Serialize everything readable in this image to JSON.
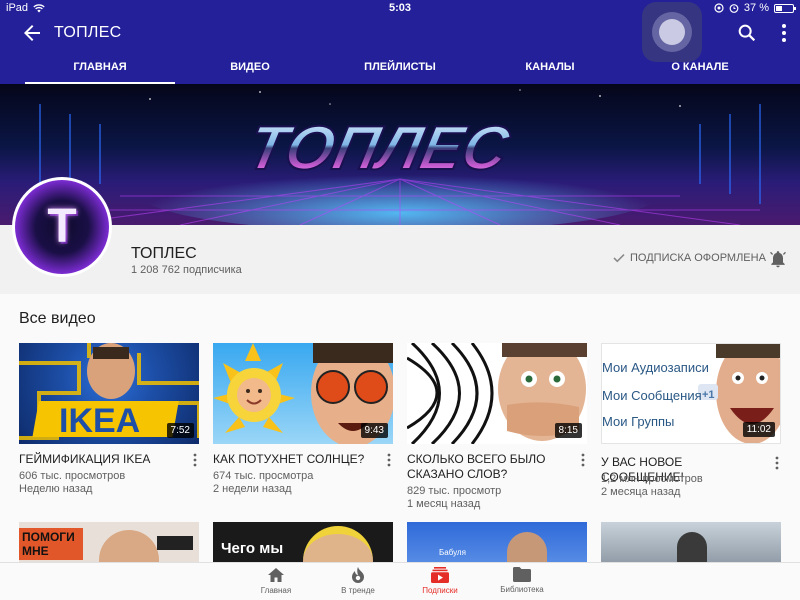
{
  "status_bar": {
    "device": "iPad",
    "time": "5:03",
    "battery": "37 %",
    "battery_level": 0.37
  },
  "header": {
    "title": "ТОПЛЕС",
    "bg_color": "#24209a"
  },
  "tabs": [
    {
      "label": "ГЛАВНАЯ",
      "active": true
    },
    {
      "label": "ВИДЕО",
      "active": false
    },
    {
      "label": "ПЛЕЙЛИСТЫ",
      "active": false
    },
    {
      "label": "КАНАЛЫ",
      "active": false
    },
    {
      "label": "О КАНАЛЕ",
      "active": false
    }
  ],
  "banner": {
    "text": "ТОПЛЕС"
  },
  "channel": {
    "avatar_letter": "T",
    "name": "ТОПЛЕС",
    "subscribers": "1 208 762 подписчика",
    "subscription_status": "ПОДПИСКА ОФОРМЛЕНА"
  },
  "section": {
    "title": "Все видео"
  },
  "videos": [
    {
      "title": "ГЕЙМИФИКАЦИЯ IKEA",
      "views": "606 тыс. просмотров",
      "age": "Неделю назад",
      "duration": "7:52",
      "thumb_text": "IKEA"
    },
    {
      "title": "КАК ПОТУХНЕТ СОЛНЦЕ?",
      "views": "674 тыс. просмотра",
      "age": "2 недели назад",
      "duration": "9:43"
    },
    {
      "title": "СКОЛЬКО ВСЕГО БЫЛО СКАЗАНО СЛОВ?",
      "views": "829 тыс. просмотр",
      "age": "1 месяц назад",
      "duration": "8:15"
    },
    {
      "title": "У ВАС НОВОЕ СООБЩЕНИЕ!",
      "views": "1,2 млн просмотров",
      "age": "2 месяца назад",
      "duration": "11:02",
      "thumb_lines": [
        "Мои Аудиозаписи",
        "Мои Сообщения",
        "Мои Группы"
      ],
      "thumb_badge": "+1"
    }
  ],
  "row2_thumbs": [
    {
      "text": "ПОМОГИ МНЕ"
    },
    {
      "text": "Чего мы"
    },
    {
      "text": "Бабуля"
    },
    {
      "text": ""
    }
  ],
  "bottom_nav": [
    {
      "label": "Главная",
      "icon": "home-icon",
      "active": false
    },
    {
      "label": "В тренде",
      "icon": "flame-icon",
      "active": false
    },
    {
      "label": "Подписки",
      "icon": "subscriptions-icon",
      "active": true
    },
    {
      "label": "Библиотека",
      "icon": "folder-icon",
      "active": false
    }
  ]
}
